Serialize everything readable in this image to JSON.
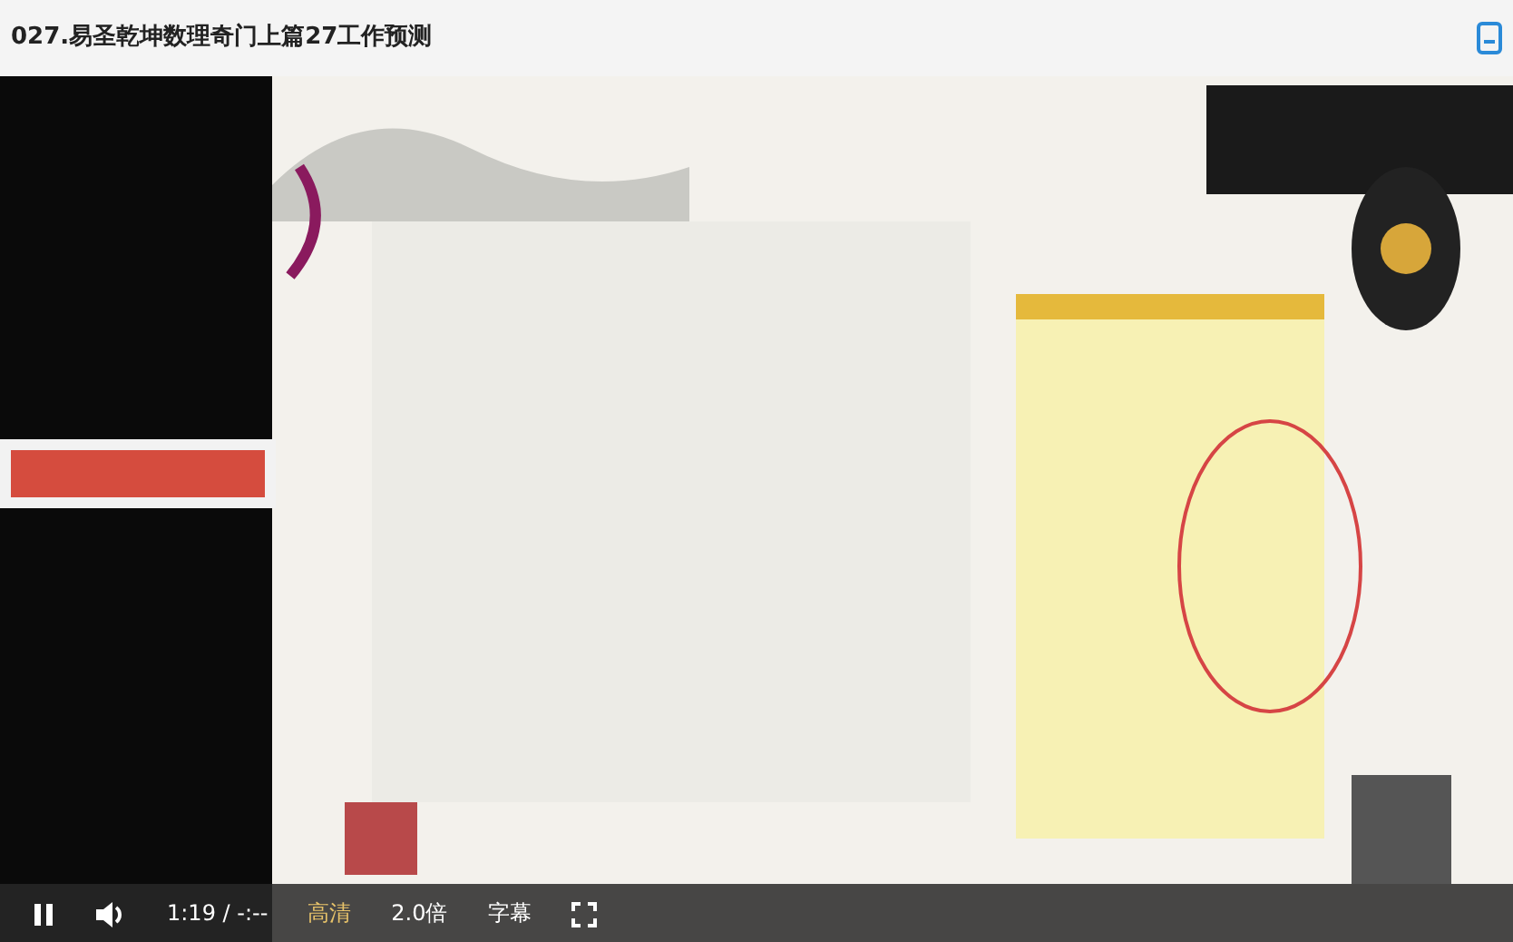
{
  "window": {
    "title": "027.易圣乾坤数理奇门上篇27工作预测"
  },
  "controls": {
    "time": "1:19 / -:--",
    "quality": {
      "label": "高清",
      "active": true
    },
    "speed": "2.0倍",
    "subtitles": "字幕"
  }
}
